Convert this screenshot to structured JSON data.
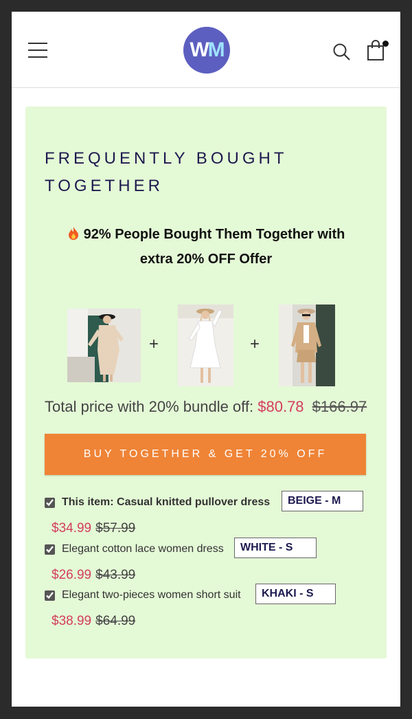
{
  "header": {
    "logo_text_w": "W",
    "logo_text_m": "M",
    "icons": {
      "menu": "hamburger-menu-icon",
      "search": "search-icon",
      "cart": "shopping-bag-icon"
    }
  },
  "bundle": {
    "title": "FREQUENTLY BOUGHT TOGETHER",
    "offer_line1": "92% People Bought Them Together with",
    "offer_line2": "extra 20% OFF Offer",
    "plus": "+",
    "total_label": "Total price with 20% bundle off:",
    "total_price": "$80.78",
    "total_original": "$166.97",
    "buy_button": "BUY TOGETHER & GET 20% OFF",
    "items": [
      {
        "name": "This item: Casual knitted pullover dress",
        "variant": "BEIGE - M",
        "price": "$34.99",
        "original": "$57.99",
        "checked": true
      },
      {
        "name": "Elegant cotton lace women dress",
        "variant": "WHITE - S",
        "price": "$26.99",
        "original": "$43.99",
        "checked": true
      },
      {
        "name": "Elegant two-pieces women short suit",
        "variant": "KHAKI - S",
        "price": "$38.99",
        "original": "$64.99",
        "checked": true
      }
    ]
  },
  "colors": {
    "panel": "#e4f9d6",
    "accent": "#ef8437",
    "price": "#d43d5c",
    "title": "#1d1a4f"
  }
}
